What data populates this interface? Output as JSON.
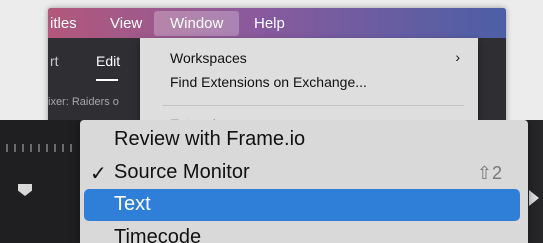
{
  "menubar": {
    "items": [
      {
        "label": "itles"
      },
      {
        "label": "View"
      },
      {
        "label": "Window"
      },
      {
        "label": "Help"
      }
    ],
    "active_item": "Window"
  },
  "app": {
    "tabs": [
      {
        "label": "rt"
      },
      {
        "label": "Edit"
      }
    ],
    "mixer_label": "ixer: Raiders o"
  },
  "window_menu": {
    "items": [
      {
        "label": "Workspaces",
        "submenu_icon": "chevron-right-icon"
      },
      {
        "label": "Find Extensions on Exchange..."
      },
      {
        "label": "Extensions",
        "submenu_icon": "chevron-right-icon",
        "faded": true
      }
    ]
  },
  "zoomed_menu": {
    "items": [
      {
        "label": "Review with Frame.io"
      },
      {
        "label": "Source Monitor",
        "checked": true,
        "shortcut": "⇧2"
      },
      {
        "label": "Text",
        "highlighted": true
      },
      {
        "label": "Timecode"
      }
    ],
    "highlight_color": "#2f7fd9"
  },
  "icons": {
    "submenu_arrow": "›",
    "check": "✓"
  }
}
